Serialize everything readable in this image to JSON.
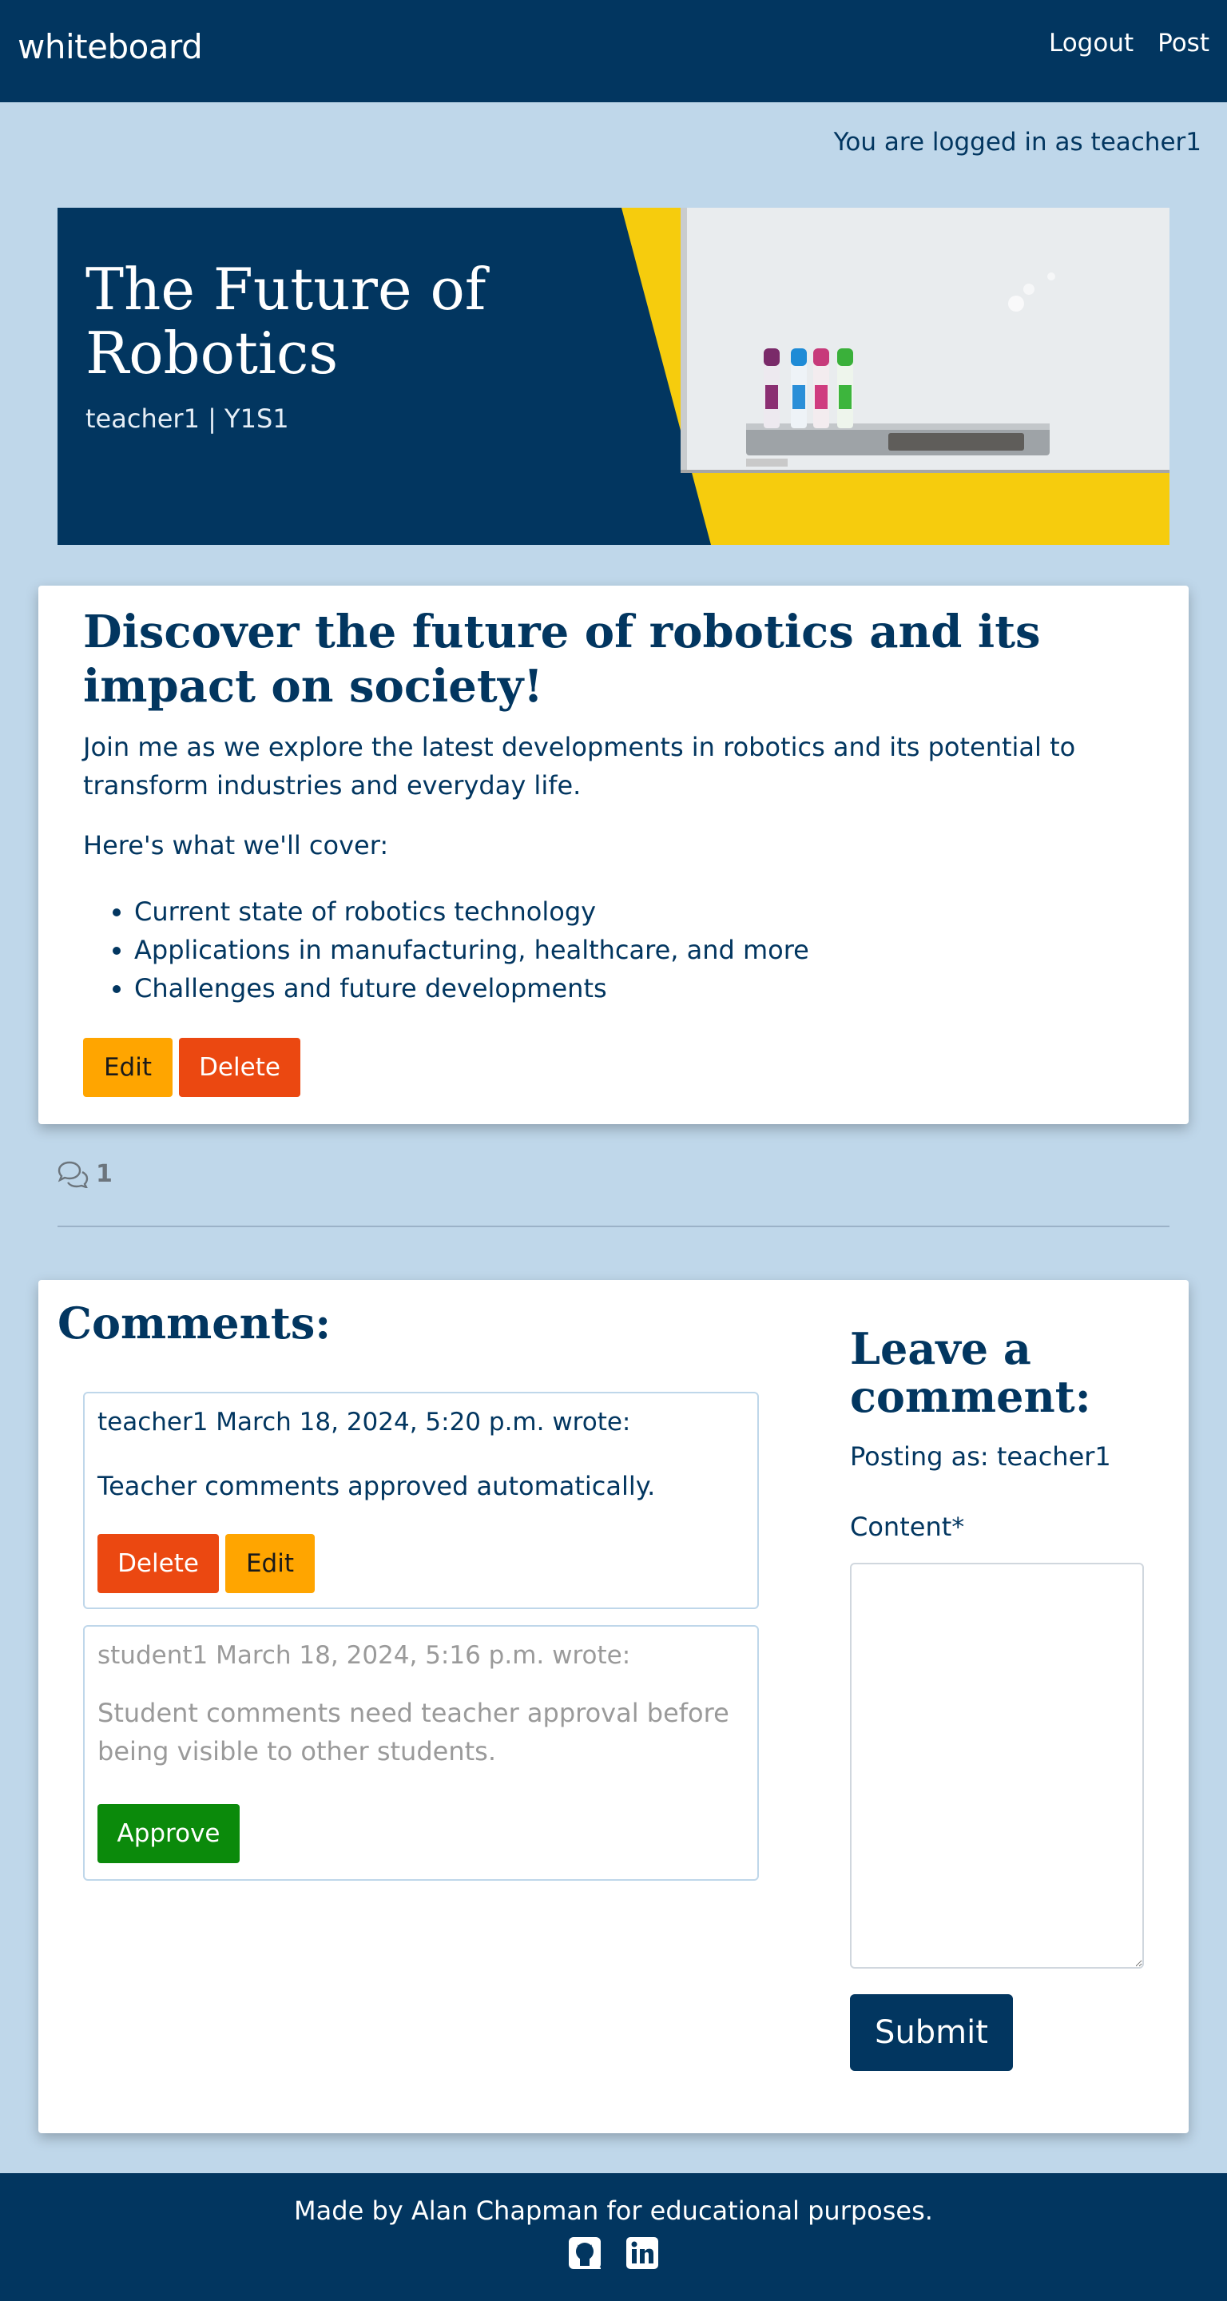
{
  "navbar": {
    "brand": "whiteboard",
    "links": [
      "Logout",
      "Post"
    ]
  },
  "status": {
    "logged_in_text": "You are logged in as teacher1"
  },
  "hero": {
    "title": "The Future of Robotics",
    "meta": "teacher1 | Y1S1"
  },
  "post": {
    "heading": "Discover the future of robotics and its impact on society!",
    "intro": "Join me as we explore the latest developments in robotics and its potential to transform industries and everyday life.",
    "cover_label": "Here's what we'll cover:",
    "topics": [
      "Current state of robotics technology",
      "Applications in manufacturing, healthcare, and more",
      "Challenges and future developments"
    ],
    "edit_label": "Edit",
    "delete_label": "Delete"
  },
  "comment_count": "1",
  "comments_section": {
    "title": "Comments:",
    "comments": [
      {
        "header": "teacher1 March 18, 2024, 5:20 p.m. wrote:",
        "body": "Teacher comments approved automatically.",
        "delete_label": "Delete",
        "edit_label": "Edit"
      },
      {
        "header": "student1 March 18, 2024, 5:16 p.m. wrote:",
        "body": "Student comments need teacher approval before being visible to other students.",
        "approve_label": "Approve"
      }
    ]
  },
  "comment_form": {
    "title": "Leave a comment:",
    "posting_as": "Posting as: teacher1",
    "content_label": "Content*",
    "submit_label": "Submit"
  },
  "footer": {
    "text": "Made by Alan Chapman for educational purposes.",
    "icons": [
      "github-icon",
      "linkedin-icon"
    ]
  },
  "colors": {
    "primary": "#023660",
    "background": "#bfd7ea",
    "edit": "#ffa500",
    "delete": "#eb4811",
    "approve": "#0b8a0b"
  }
}
